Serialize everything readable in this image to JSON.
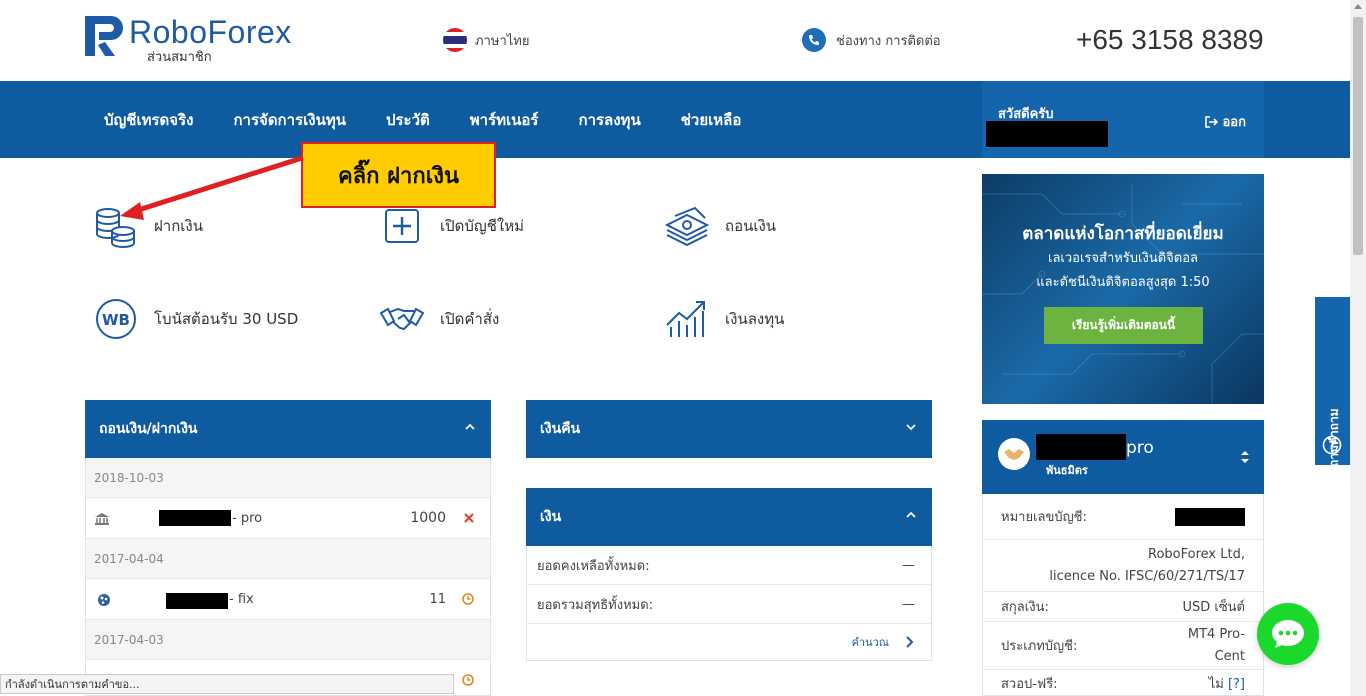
{
  "header": {
    "brand": "RoboForex",
    "brand_sub": "ส่วนสมาชิก",
    "language": "ภาษาไทย",
    "contact": "ช่องทาง การติดต่อ",
    "phone": "+65 3158 8389"
  },
  "nav": {
    "items": [
      "บัญชีเทรดจริง",
      "การจัดการเงินทุน",
      "ประวัติ",
      "พาร์ทเนอร์",
      "การลงทุน",
      "ช่วยเหลือ"
    ],
    "greeting": "สวัสดีครับ",
    "logout": "ออก"
  },
  "callout": "คลิ๊ก ฝากเงิน",
  "quick_actions": {
    "deposit": "ฝากเงิน",
    "open_account": "เปิดบัญชีใหม่",
    "withdraw": "ถอนเงิน",
    "bonus": "โบนัสต้อนรับ 30 USD",
    "open_order": "เปิดคำสั่ง",
    "invest": "เงินลงทุน"
  },
  "transactions_panel": {
    "title": "ถอนเงิน/ฝากเงิน",
    "groups": [
      {
        "date": "2018-10-03",
        "suffix": "- pro",
        "amount": "1000",
        "status": "cancelled"
      },
      {
        "date": "2017-04-04",
        "suffix": "- fix",
        "amount": "11",
        "status": "pending"
      },
      {
        "date": "2017-04-03"
      }
    ]
  },
  "refund_panel": {
    "title": "เงินคืน"
  },
  "money_panel": {
    "title": "เงิน",
    "rows": [
      {
        "label": "ยอดคงเหลือทั้งหมด:",
        "value": "—"
      },
      {
        "label": "ยอดรวมสุทธิทั้งหมด:",
        "value": "—"
      }
    ],
    "calc": "คำนวณ"
  },
  "promo": {
    "title": "ตลาดแห่งโอกาสที่ยอดเยี่ยม",
    "line1": "เลเวอเรจสำหรับเงินดิจิตอล",
    "line2": "และดัชนีเงินดิจิตอลสูงสุด 1:50",
    "button": "เรียนรู้เพิ่มเติมตอนนี้"
  },
  "account": {
    "name_suffix": "pro",
    "role": "พันธมิตร",
    "rows": [
      {
        "label": "หมายเลขบัญชี:",
        "value": ""
      },
      {
        "label": "",
        "value": "RoboForex Ltd,"
      },
      {
        "label": "",
        "value": "licence No. IFSC/60/271/TS/17"
      },
      {
        "label": "สกุลเงิน:",
        "value": "USD เซ็นต์"
      },
      {
        "label": "ประเภทบัญชี:",
        "value": "MT4 Pro-"
      },
      {
        "label": "",
        "value": "Cent"
      },
      {
        "label": "สวอป-ฟรี:",
        "value": "ไม่",
        "link": "[?]"
      }
    ]
  },
  "side_tab": "ถามคำถาม",
  "status_bar": "กำลังดำเนินการตามคำขอ...",
  "colors": {
    "primary": "#0e5b9f",
    "accent_green": "#6cb33f",
    "callout_yellow": "#ffcc00",
    "callout_red": "#e02020",
    "chat_green": "#1ad82c"
  }
}
